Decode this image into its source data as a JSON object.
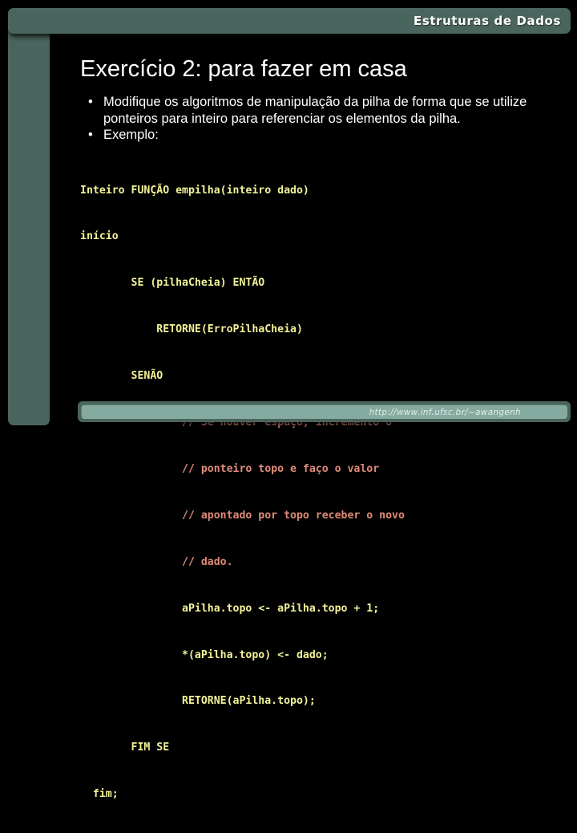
{
  "colors": {
    "slide_background": "#000000",
    "banner": "#4a655d",
    "footer_panel": "#85aaa0",
    "title_text": "#ffffff",
    "code_text": "#f2f299",
    "code_comment": "#e08a78"
  },
  "header": {
    "course_title": "Estruturas de Dados"
  },
  "slide": {
    "title": "Exercício 2: para fazer em casa",
    "bullets": [
      {
        "marker": "•",
        "text": "Modifique os algoritmos de manipulação da pilha de forma que se utilize ponteiros para inteiro para referenciar os elementos da pilha."
      },
      {
        "marker": "•",
        "text": "Exemplo:"
      }
    ],
    "code_lines": [
      {
        "text": "Inteiro FUNÇÃO empilha(inteiro dado)",
        "kind": "code"
      },
      {
        "text": "início",
        "kind": "code"
      },
      {
        "text": "        SE (pilhaCheia) ENTÃO",
        "kind": "code"
      },
      {
        "text": "            RETORNE(ErroPilhaCheia)",
        "kind": "code"
      },
      {
        "text": "        SENÃO",
        "kind": "code"
      },
      {
        "text": "                // Se houver espaço, incremento o",
        "kind": "comment"
      },
      {
        "text": "                // ponteiro topo e faço o valor",
        "kind": "comment"
      },
      {
        "text": "                // apontado por topo receber o novo",
        "kind": "comment"
      },
      {
        "text": "                // dado.",
        "kind": "comment"
      },
      {
        "text": "                aPilha.topo <- aPilha.topo + 1;",
        "kind": "code"
      },
      {
        "text": "                *(aPilha.topo) <- dado;",
        "kind": "code"
      },
      {
        "text": "                RETORNE(aPilha.topo);",
        "kind": "code"
      },
      {
        "text": "        FIM SE",
        "kind": "code"
      },
      {
        "text": "  fim;",
        "kind": "code"
      }
    ]
  },
  "footer": {
    "url": "http://www.inf.ufsc.br/~awangenh"
  }
}
